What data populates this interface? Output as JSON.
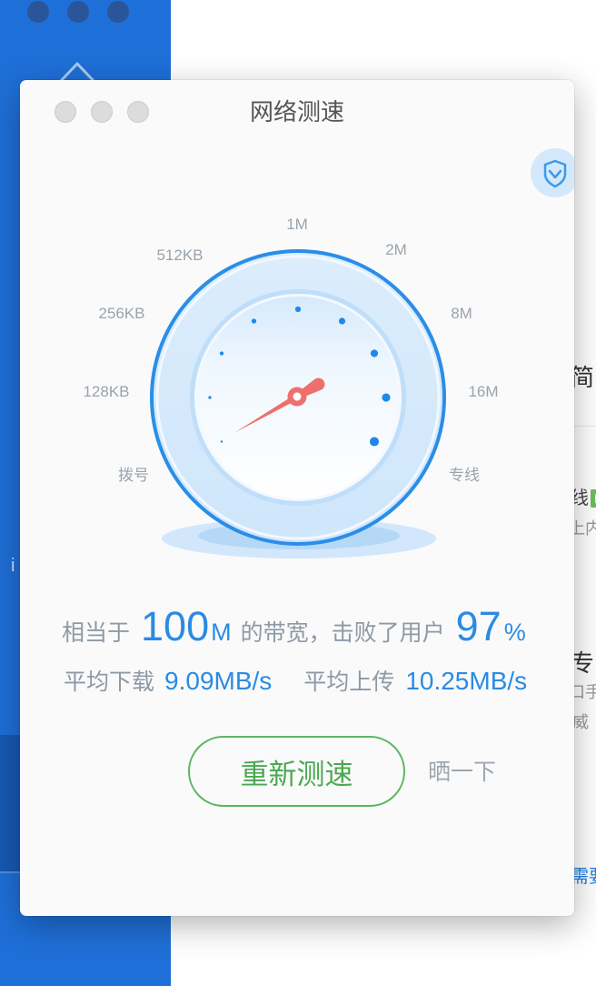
{
  "sidebar": {
    "item_fragment": "i",
    "icons": {
      "home": "home-icon"
    }
  },
  "content_fragments": [
    {
      "text": "简"
    },
    {
      "text": "线",
      "badge": "N"
    },
    {
      "text": "上内"
    },
    {
      "text": "专"
    },
    {
      "text": "口手"
    },
    {
      "text": "威"
    },
    {
      "text": "需要"
    }
  ],
  "dialog": {
    "title": "网络测速",
    "icons": {
      "shield": "shield-icon"
    },
    "gauge": {
      "scale_labels": [
        "拨号",
        "128KB",
        "256KB",
        "512KB",
        "1M",
        "2M",
        "8M",
        "16M",
        "专线"
      ],
      "needle_fraction": 0
    },
    "result": {
      "prefix": "相当于",
      "bandwidth_value": "100",
      "bandwidth_unit": "M",
      "middle": "的带宽，击败了用户",
      "beat_value": "97",
      "beat_unit": "%"
    },
    "speeds": {
      "download_label": "平均下载",
      "download_value": "9.09MB/s",
      "upload_label": "平均上传",
      "upload_value": "10.25MB/s"
    },
    "retest_button": "重新测速",
    "share_link": "晒一下"
  },
  "colors": {
    "sidebar_blue": "#1f6fd8",
    "accent_blue": "#2a8be5",
    "needle_red": "#ef6e6e",
    "button_green": "#4aa852",
    "muted_gray": "#8d99a6"
  }
}
